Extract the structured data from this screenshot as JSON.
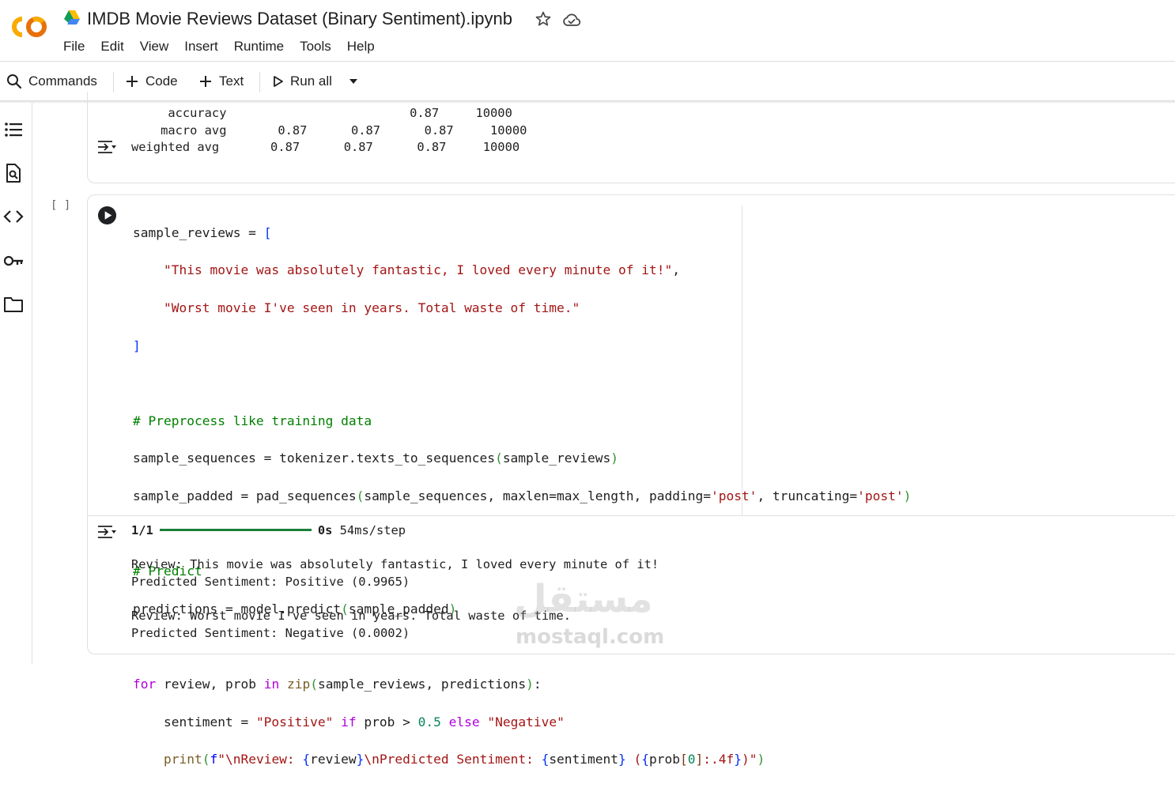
{
  "app": {
    "notebook_title": "IMDB Movie Reviews Dataset (Binary Sentiment).ipynb",
    "brand_colors": {
      "logo_orange": "#f9ab00",
      "logo_dark_orange": "#e8710a",
      "run_button": "#202124",
      "progress_green": "#1a7f37"
    }
  },
  "menu": {
    "items": [
      "File",
      "Edit",
      "View",
      "Insert",
      "Runtime",
      "Tools",
      "Help"
    ]
  },
  "toolbar": {
    "commands_label": "Commands",
    "code_label": "Code",
    "text_label": "Text",
    "run_all_label": "Run all"
  },
  "sidebar": {
    "icons": [
      "table-of-contents-icon",
      "find-icon",
      "code-snippets-icon",
      "secrets-key-icon",
      "files-folder-icon"
    ]
  },
  "cell1_output": {
    "lines": [
      "     accuracy                         0.87     10000",
      "    macro avg       0.87      0.87      0.87     10000",
      "weighted avg       0.87      0.87      0.87     10000"
    ]
  },
  "cell2": {
    "execution_count": "[ ]",
    "code_lines": [
      "sample_reviews = [",
      "    \"This movie was absolutely fantastic, I loved every minute of it!\",",
      "    \"Worst movie I've seen in years. Total waste of time.\"",
      "]",
      "",
      "# Preprocess like training data",
      "sample_sequences = tokenizer.texts_to_sequences(sample_reviews)",
      "sample_padded = pad_sequences(sample_sequences, maxlen=max_length, padding='post', truncating='post')",
      "",
      "# Predict",
      "predictions = model.predict(sample_padded)",
      "",
      "for review, prob in zip(sample_reviews, predictions):",
      "    sentiment = \"Positive\" if prob > 0.5 else \"Negative\"",
      "    print(f\"\\nReview: {review}\\nPredicted Sentiment: {sentiment} ({prob[0]:.4f})\")"
    ],
    "output": {
      "progress_step": "1/1",
      "progress_fraction": 1.0,
      "progress_time": "0s",
      "progress_rate": "54ms/step",
      "lines": [
        "",
        "Review: This movie was absolutely fantastic, I loved every minute of it!",
        "Predicted Sentiment: Positive (0.9965)",
        "",
        "Review: Worst movie I've seen in years. Total waste of time.",
        "Predicted Sentiment: Negative (0.0002)"
      ]
    }
  },
  "watermark": {
    "arabic": "مستقل",
    "latin": "mostaql.com"
  }
}
